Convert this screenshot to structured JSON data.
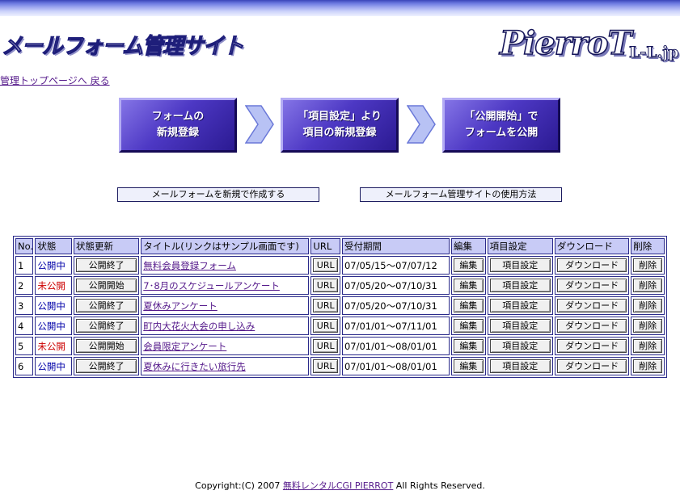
{
  "header": {
    "title": "メールフォーム管理サイト",
    "logo_main": "PierroT",
    "logo_sub": "L-L.jp"
  },
  "nav": {
    "back_link": "管理トップページへ 戻る"
  },
  "steps": [
    {
      "line1": "フォームの",
      "line2": "新規登録"
    },
    {
      "line1": "「項目設定」より",
      "line2": "項目の新規登録"
    },
    {
      "line1": "「公開開始」で",
      "line2": "フォームを公開"
    }
  ],
  "links": {
    "create_new": "メールフォームを新規で作成する",
    "usage": "メールフォーム管理サイトの使用方法"
  },
  "table": {
    "headers": {
      "no": "No.",
      "status": "状態",
      "status_update": "状態更新",
      "title": "タイトル(リンクはサンプル画面です)",
      "url": "URL",
      "period": "受付期間",
      "edit": "編集",
      "items": "項目設定",
      "download": "ダウンロード",
      "delete": "削除"
    },
    "rows": [
      {
        "no": "1",
        "status": "公開中",
        "status_type": "open",
        "update": "公開終了",
        "title": "無料会員登録フォーム",
        "url": "URL",
        "period": "07/05/15～07/07/12",
        "edit": "編集",
        "items": "項目設定",
        "download": "ダウンロード",
        "delete": "削除"
      },
      {
        "no": "2",
        "status": "未公開",
        "status_type": "closed",
        "update": "公開開始",
        "title": "7･8月のスケジュールアンケート",
        "url": "URL",
        "period": "07/05/20～07/10/31",
        "edit": "編集",
        "items": "項目設定",
        "download": "ダウンロード",
        "delete": "削除"
      },
      {
        "no": "3",
        "status": "公開中",
        "status_type": "open",
        "update": "公開終了",
        "title": "夏休みアンケート",
        "url": "URL",
        "period": "07/05/20～07/10/31",
        "edit": "編集",
        "items": "項目設定",
        "download": "ダウンロード",
        "delete": "削除"
      },
      {
        "no": "4",
        "status": "公開中",
        "status_type": "open",
        "update": "公開終了",
        "title": "町内大花火大会の申し込み",
        "url": "URL",
        "period": "07/01/01～07/11/01",
        "edit": "編集",
        "items": "項目設定",
        "download": "ダウンロード",
        "delete": "削除"
      },
      {
        "no": "5",
        "status": "未公開",
        "status_type": "closed",
        "update": "公開開始",
        "title": "会員限定アンケート",
        "url": "URL",
        "period": "07/01/01～08/01/01",
        "edit": "編集",
        "items": "項目設定",
        "download": "ダウンロード",
        "delete": "削除"
      },
      {
        "no": "6",
        "status": "公開中",
        "status_type": "open",
        "update": "公開終了",
        "title": "夏休みに行きたい旅行先",
        "url": "URL",
        "period": "07/01/01～08/01/01",
        "edit": "編集",
        "items": "項目設定",
        "download": "ダウンロード",
        "delete": "削除"
      }
    ]
  },
  "footer": {
    "prefix": "Copyright:(C) 2007 ",
    "link": "無料レンタルCGI PIERROT",
    "suffix": " All Rights Reserved."
  },
  "colors": {
    "status_open": "#0000a8",
    "status_closed": "#cc0000",
    "header_bg": "#c8cbf6",
    "step_button": "#4d38c4"
  }
}
